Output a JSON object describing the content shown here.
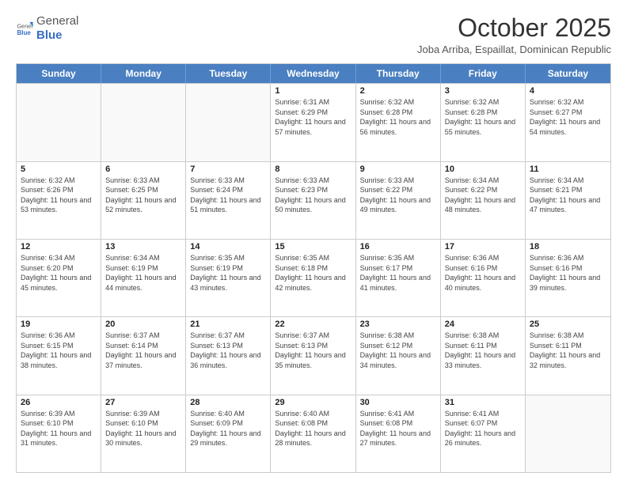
{
  "logo": {
    "general": "General",
    "blue": "Blue"
  },
  "header": {
    "month": "October 2025",
    "location": "Joba Arriba, Espaillat, Dominican Republic"
  },
  "weekdays": [
    "Sunday",
    "Monday",
    "Tuesday",
    "Wednesday",
    "Thursday",
    "Friday",
    "Saturday"
  ],
  "weeks": [
    [
      {
        "day": "",
        "info": ""
      },
      {
        "day": "",
        "info": ""
      },
      {
        "day": "",
        "info": ""
      },
      {
        "day": "1",
        "info": "Sunrise: 6:31 AM\nSunset: 6:29 PM\nDaylight: 11 hours and 57 minutes."
      },
      {
        "day": "2",
        "info": "Sunrise: 6:32 AM\nSunset: 6:28 PM\nDaylight: 11 hours and 56 minutes."
      },
      {
        "day": "3",
        "info": "Sunrise: 6:32 AM\nSunset: 6:28 PM\nDaylight: 11 hours and 55 minutes."
      },
      {
        "day": "4",
        "info": "Sunrise: 6:32 AM\nSunset: 6:27 PM\nDaylight: 11 hours and 54 minutes."
      }
    ],
    [
      {
        "day": "5",
        "info": "Sunrise: 6:32 AM\nSunset: 6:26 PM\nDaylight: 11 hours and 53 minutes."
      },
      {
        "day": "6",
        "info": "Sunrise: 6:33 AM\nSunset: 6:25 PM\nDaylight: 11 hours and 52 minutes."
      },
      {
        "day": "7",
        "info": "Sunrise: 6:33 AM\nSunset: 6:24 PM\nDaylight: 11 hours and 51 minutes."
      },
      {
        "day": "8",
        "info": "Sunrise: 6:33 AM\nSunset: 6:23 PM\nDaylight: 11 hours and 50 minutes."
      },
      {
        "day": "9",
        "info": "Sunrise: 6:33 AM\nSunset: 6:22 PM\nDaylight: 11 hours and 49 minutes."
      },
      {
        "day": "10",
        "info": "Sunrise: 6:34 AM\nSunset: 6:22 PM\nDaylight: 11 hours and 48 minutes."
      },
      {
        "day": "11",
        "info": "Sunrise: 6:34 AM\nSunset: 6:21 PM\nDaylight: 11 hours and 47 minutes."
      }
    ],
    [
      {
        "day": "12",
        "info": "Sunrise: 6:34 AM\nSunset: 6:20 PM\nDaylight: 11 hours and 45 minutes."
      },
      {
        "day": "13",
        "info": "Sunrise: 6:34 AM\nSunset: 6:19 PM\nDaylight: 11 hours and 44 minutes."
      },
      {
        "day": "14",
        "info": "Sunrise: 6:35 AM\nSunset: 6:19 PM\nDaylight: 11 hours and 43 minutes."
      },
      {
        "day": "15",
        "info": "Sunrise: 6:35 AM\nSunset: 6:18 PM\nDaylight: 11 hours and 42 minutes."
      },
      {
        "day": "16",
        "info": "Sunrise: 6:35 AM\nSunset: 6:17 PM\nDaylight: 11 hours and 41 minutes."
      },
      {
        "day": "17",
        "info": "Sunrise: 6:36 AM\nSunset: 6:16 PM\nDaylight: 11 hours and 40 minutes."
      },
      {
        "day": "18",
        "info": "Sunrise: 6:36 AM\nSunset: 6:16 PM\nDaylight: 11 hours and 39 minutes."
      }
    ],
    [
      {
        "day": "19",
        "info": "Sunrise: 6:36 AM\nSunset: 6:15 PM\nDaylight: 11 hours and 38 minutes."
      },
      {
        "day": "20",
        "info": "Sunrise: 6:37 AM\nSunset: 6:14 PM\nDaylight: 11 hours and 37 minutes."
      },
      {
        "day": "21",
        "info": "Sunrise: 6:37 AM\nSunset: 6:13 PM\nDaylight: 11 hours and 36 minutes."
      },
      {
        "day": "22",
        "info": "Sunrise: 6:37 AM\nSunset: 6:13 PM\nDaylight: 11 hours and 35 minutes."
      },
      {
        "day": "23",
        "info": "Sunrise: 6:38 AM\nSunset: 6:12 PM\nDaylight: 11 hours and 34 minutes."
      },
      {
        "day": "24",
        "info": "Sunrise: 6:38 AM\nSunset: 6:11 PM\nDaylight: 11 hours and 33 minutes."
      },
      {
        "day": "25",
        "info": "Sunrise: 6:38 AM\nSunset: 6:11 PM\nDaylight: 11 hours and 32 minutes."
      }
    ],
    [
      {
        "day": "26",
        "info": "Sunrise: 6:39 AM\nSunset: 6:10 PM\nDaylight: 11 hours and 31 minutes."
      },
      {
        "day": "27",
        "info": "Sunrise: 6:39 AM\nSunset: 6:10 PM\nDaylight: 11 hours and 30 minutes."
      },
      {
        "day": "28",
        "info": "Sunrise: 6:40 AM\nSunset: 6:09 PM\nDaylight: 11 hours and 29 minutes."
      },
      {
        "day": "29",
        "info": "Sunrise: 6:40 AM\nSunset: 6:08 PM\nDaylight: 11 hours and 28 minutes."
      },
      {
        "day": "30",
        "info": "Sunrise: 6:41 AM\nSunset: 6:08 PM\nDaylight: 11 hours and 27 minutes."
      },
      {
        "day": "31",
        "info": "Sunrise: 6:41 AM\nSunset: 6:07 PM\nDaylight: 11 hours and 26 minutes."
      },
      {
        "day": "",
        "info": ""
      }
    ]
  ]
}
